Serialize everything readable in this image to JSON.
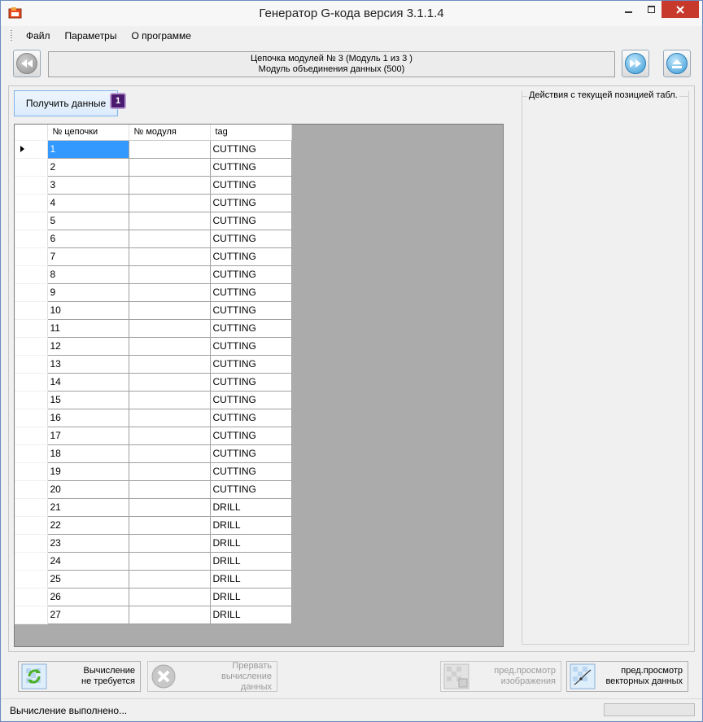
{
  "window": {
    "title": "Генератор G-кода версия 3.1.1.4"
  },
  "menu": [
    {
      "label": "Файл"
    },
    {
      "label": "Параметры"
    },
    {
      "label": "О программе"
    }
  ],
  "chain": {
    "line1": "Цепочка модулей № 3 (Модуль 1 из 3 )",
    "line2": "Модуль объединения данных (500)"
  },
  "get_data_label": "Получить данные",
  "badge": "1",
  "grid": {
    "columns": [
      "№ цепочки",
      "№ модуля",
      "tag"
    ],
    "rows": [
      [
        "1",
        "",
        "CUTTING"
      ],
      [
        "2",
        "",
        "CUTTING"
      ],
      [
        "3",
        "",
        "CUTTING"
      ],
      [
        "4",
        "",
        "CUTTING"
      ],
      [
        "5",
        "",
        "CUTTING"
      ],
      [
        "6",
        "",
        "CUTTING"
      ],
      [
        "7",
        "",
        "CUTTING"
      ],
      [
        "8",
        "",
        "CUTTING"
      ],
      [
        "9",
        "",
        "CUTTING"
      ],
      [
        "10",
        "",
        "CUTTING"
      ],
      [
        "11",
        "",
        "CUTTING"
      ],
      [
        "12",
        "",
        "CUTTING"
      ],
      [
        "13",
        "",
        "CUTTING"
      ],
      [
        "14",
        "",
        "CUTTING"
      ],
      [
        "15",
        "",
        "CUTTING"
      ],
      [
        "16",
        "",
        "CUTTING"
      ],
      [
        "17",
        "",
        "CUTTING"
      ],
      [
        "18",
        "",
        "CUTTING"
      ],
      [
        "19",
        "",
        "CUTTING"
      ],
      [
        "20",
        "",
        "CUTTING"
      ],
      [
        "21",
        "",
        "DRILL"
      ],
      [
        "22",
        "",
        "DRILL"
      ],
      [
        "23",
        "",
        "DRILL"
      ],
      [
        "24",
        "",
        "DRILL"
      ],
      [
        "25",
        "",
        "DRILL"
      ],
      [
        "26",
        "",
        "DRILL"
      ],
      [
        "27",
        "",
        "DRILL"
      ]
    ]
  },
  "actions_title": "Действия с текущей позицией табл.",
  "buttons": {
    "calc": {
      "line1": "Вычисление",
      "line2": "не требуется"
    },
    "abort": {
      "line1": "Прервать вычисление",
      "line2": "данных"
    },
    "img_preview": {
      "line1": "пред.просмотр",
      "line2": "изображения"
    },
    "vec_preview": {
      "line1": "пред.просмотр",
      "line2": "векторных данных"
    }
  },
  "status": "Вычисление выполнено...",
  "icons": {
    "prev": "rewind-icon",
    "next": "fast-forward-icon",
    "eject": "eject-icon",
    "calc": "refresh-icon",
    "abort": "close-icon",
    "img_preview": "image-preview-icon",
    "vec_preview": "vector-preview-icon"
  }
}
